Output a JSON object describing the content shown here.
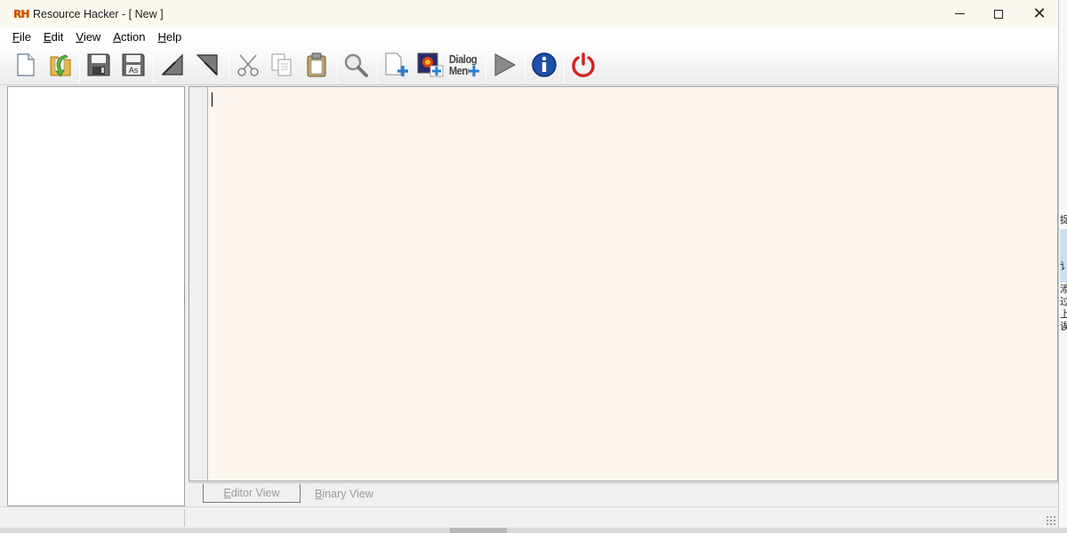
{
  "window": {
    "title": "Resource Hacker - [ New ]",
    "app_icon_text": "RH",
    "controls": {
      "close_glyph": "✕"
    }
  },
  "menu": [
    {
      "accel": "F",
      "rest": "ile"
    },
    {
      "accel": "E",
      "rest": "dit"
    },
    {
      "accel": "V",
      "rest": "iew"
    },
    {
      "accel": "A",
      "rest": "ction"
    },
    {
      "accel": "H",
      "rest": "elp"
    }
  ],
  "toolbar": {
    "dialog_menu_top": "Dialog",
    "dialog_menu_bottom": "Menu",
    "icons": [
      "new-file-icon",
      "open-file-icon",
      "save-icon",
      "save-as-icon",
      "import-icon",
      "export-icon",
      "cut-icon",
      "copy-icon",
      "paste-icon",
      "search-icon",
      "add-resource-icon",
      "add-image-icon",
      "dialog-merger-icon",
      "run-script-icon",
      "info-icon",
      "exit-icon"
    ],
    "colors": {
      "green": "#5ab83c",
      "blue_info": "#1f4fa8",
      "red_power": "#d42020"
    }
  },
  "editor": {
    "background": "#fdf6f0",
    "tabs": {
      "editor_accel": "E",
      "editor_rest": "ditor View",
      "binary_accel": "B",
      "binary_rest": "inary View"
    }
  },
  "right_edge_glyphs": [
    "捉",
    "讠",
    "添",
    "过",
    "上",
    "诶"
  ]
}
